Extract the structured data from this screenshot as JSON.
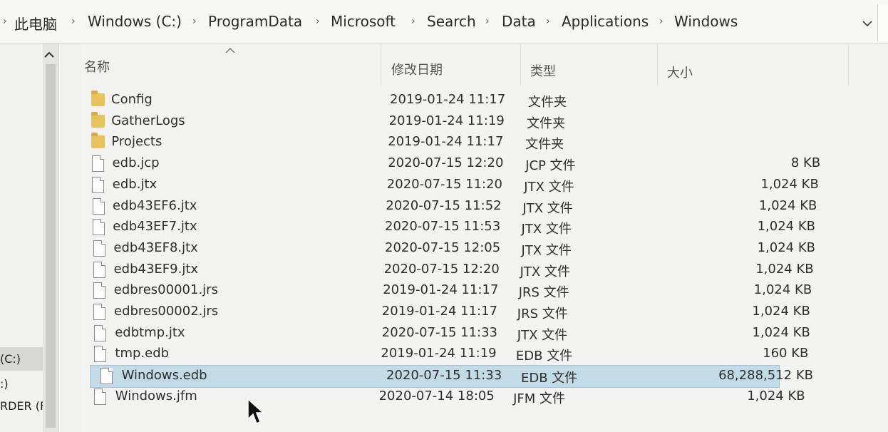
{
  "breadcrumb": {
    "items": [
      "此电脑",
      "Windows (C:)",
      "ProgramData",
      "Microsoft",
      "Search",
      "Data",
      "Applications",
      "Windows"
    ],
    "separator": "›"
  },
  "nav": {
    "drive_c": "(C:)",
    "drive_e": ":)",
    "drive_f": "RDER (F:)"
  },
  "columns": {
    "name": "名称",
    "date": "修改日期",
    "type": "类型",
    "size": "大小"
  },
  "files": [
    {
      "name": "Config",
      "date": "2019-01-24 11:17",
      "type": "文件夹",
      "size": "",
      "kind": "folder"
    },
    {
      "name": "GatherLogs",
      "date": "2019-01-24 11:19",
      "type": "文件夹",
      "size": "",
      "kind": "folder"
    },
    {
      "name": "Projects",
      "date": "2019-01-24 11:17",
      "type": "文件夹",
      "size": "",
      "kind": "folder"
    },
    {
      "name": "edb.jcp",
      "date": "2020-07-15 12:20",
      "type": "JCP 文件",
      "size": "8 KB",
      "kind": "file"
    },
    {
      "name": "edb.jtx",
      "date": "2020-07-15 11:20",
      "type": "JTX 文件",
      "size": "1,024 KB",
      "kind": "file"
    },
    {
      "name": "edb43EF6.jtx",
      "date": "2020-07-15 11:52",
      "type": "JTX 文件",
      "size": "1,024 KB",
      "kind": "file"
    },
    {
      "name": "edb43EF7.jtx",
      "date": "2020-07-15 11:53",
      "type": "JTX 文件",
      "size": "1,024 KB",
      "kind": "file"
    },
    {
      "name": "edb43EF8.jtx",
      "date": "2020-07-15 12:05",
      "type": "JTX 文件",
      "size": "1,024 KB",
      "kind": "file"
    },
    {
      "name": "edb43EF9.jtx",
      "date": "2020-07-15 12:20",
      "type": "JTX 文件",
      "size": "1,024 KB",
      "kind": "file"
    },
    {
      "name": "edbres00001.jrs",
      "date": "2019-01-24 11:17",
      "type": "JRS 文件",
      "size": "1,024 KB",
      "kind": "file"
    },
    {
      "name": "edbres00002.jrs",
      "date": "2019-01-24 11:17",
      "type": "JRS 文件",
      "size": "1,024 KB",
      "kind": "file"
    },
    {
      "name": "edbtmp.jtx",
      "date": "2020-07-15 11:33",
      "type": "JTX 文件",
      "size": "1,024 KB",
      "kind": "file"
    },
    {
      "name": "tmp.edb",
      "date": "2019-01-24 11:19",
      "type": "EDB 文件",
      "size": "160 KB",
      "kind": "file"
    },
    {
      "name": "Windows.edb",
      "date": "2020-07-15 11:33",
      "type": "EDB 文件",
      "size": "68,288,512 KB",
      "kind": "file",
      "selected": true
    },
    {
      "name": "Windows.jfm",
      "date": "2020-07-14 18:05",
      "type": "JFM 文件",
      "size": "1,024 KB",
      "kind": "file"
    }
  ],
  "colors": {
    "folder": "#e8c25a",
    "selection": "#c3dbe7"
  }
}
